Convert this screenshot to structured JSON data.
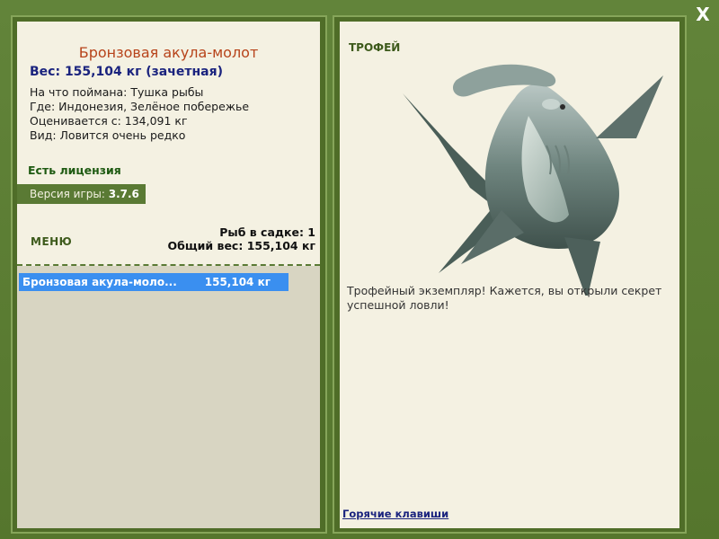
{
  "close_label": "X",
  "fish": {
    "title": "Бронзовая акула-молот",
    "weight": "Вес: 155,104 кг (зачетная)",
    "bait": "На что поймана: Тушка рыбы",
    "location": "Где: Индонезия, Зелёное побережье",
    "rated_from": "Оценивается с: 134,091 кг",
    "rarity": "Вид: Ловится очень редко"
  },
  "license": "Есть лицензия",
  "version": {
    "label": "Версия игры:",
    "value": "3.7.6"
  },
  "menu_label": "МЕНЮ",
  "keep": {
    "count": "Рыб в садке: 1",
    "total": "Общий вес: 155,104 кг"
  },
  "catch_list": [
    {
      "name": "Бронзовая акула-моло...",
      "weight": "155,104 кг"
    }
  ],
  "trophy": {
    "label": "ТРОФЕЙ",
    "text": "Трофейный экземпляр! Кажется, вы открыли секрет успешной ловли!",
    "image_icon": "hammerhead-shark-icon"
  },
  "hotkeys_label": "Горячие клавиши",
  "colors": {
    "frame": "#5a7a2e",
    "panel": "#f4f1e2",
    "title": "#b7431a",
    "weight": "#1a237e",
    "license": "#1e5a12",
    "selected_row": "#3a8ff0"
  }
}
